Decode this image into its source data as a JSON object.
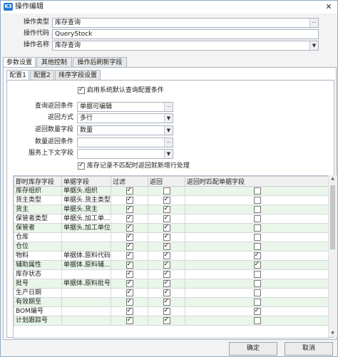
{
  "window": {
    "app_icon_text": "K3",
    "title": "操作编辑",
    "close_glyph": "✕"
  },
  "form": {
    "op_type_label": "操作类型",
    "op_type_value": "库存查询",
    "op_code_label": "操作代码",
    "op_code_value": "QueryStock",
    "op_name_label": "操作名称",
    "op_name_value": "库存查询"
  },
  "outer_tabs": [
    "参数设置",
    "其他控制",
    "操作后刷新字段"
  ],
  "inner_tabs": [
    "配置1",
    "配置2",
    "排序字段设置"
  ],
  "config": {
    "use_default_label": "启用系统默认查询配置条件",
    "query_return_cond_label": "查询返回条件",
    "query_return_cond_value": "单据可编辑",
    "return_mode_label": "返回方式",
    "return_mode_value": "多行",
    "return_qty_field_label": "返回数量字段",
    "return_qty_field_value": "数量",
    "qty_return_cond_label": "数量返回条件",
    "qty_return_cond_value": "",
    "service_context_label": "服务上下文字段",
    "service_context_value": "",
    "mismatch_label": "库存记录不匹配时返回就新增行处理"
  },
  "grid": {
    "headers": [
      "即时库存字段",
      "单据字段",
      "过滤",
      "返回",
      "返回时匹配单据字段"
    ],
    "rows": [
      {
        "field": "库存组织",
        "bill": "单据头.组织",
        "filter": true,
        "ret": false,
        "match": false
      },
      {
        "field": "货主类型",
        "bill": "单据头.货主类型",
        "filter": true,
        "ret": true,
        "match": false
      },
      {
        "field": "货主",
        "bill": "单据头.货主",
        "filter": true,
        "ret": true,
        "match": false
      },
      {
        "field": "保管者类型",
        "bill": "单据头.加工单...",
        "filter": true,
        "ret": true,
        "match": false
      },
      {
        "field": "保管者",
        "bill": "单据头.加工单位",
        "filter": true,
        "ret": true,
        "match": false
      },
      {
        "field": "仓库",
        "bill": "",
        "filter": true,
        "ret": true,
        "match": false
      },
      {
        "field": "仓位",
        "bill": "",
        "filter": true,
        "ret": true,
        "match": false
      },
      {
        "field": "物料",
        "bill": "单据体.原料代码",
        "filter": true,
        "ret": true,
        "match": true
      },
      {
        "field": "辅助属性",
        "bill": "单据体.原料辅...",
        "filter": true,
        "ret": true,
        "match": true
      },
      {
        "field": "库存状态",
        "bill": "",
        "filter": true,
        "ret": true,
        "match": false
      },
      {
        "field": "批号",
        "bill": "单据体.原料批号",
        "filter": true,
        "ret": true,
        "match": false
      },
      {
        "field": "生产日期",
        "bill": "",
        "filter": true,
        "ret": true,
        "match": false
      },
      {
        "field": "有效期至",
        "bill": "",
        "filter": true,
        "ret": true,
        "match": false
      },
      {
        "field": "BOM编号",
        "bill": "",
        "filter": true,
        "ret": true,
        "match": true
      },
      {
        "field": "计划跟踪号",
        "bill": "",
        "filter": true,
        "ret": true,
        "match": false
      }
    ]
  },
  "footer": {
    "ok_label": "确定",
    "cancel_label": "取消"
  }
}
